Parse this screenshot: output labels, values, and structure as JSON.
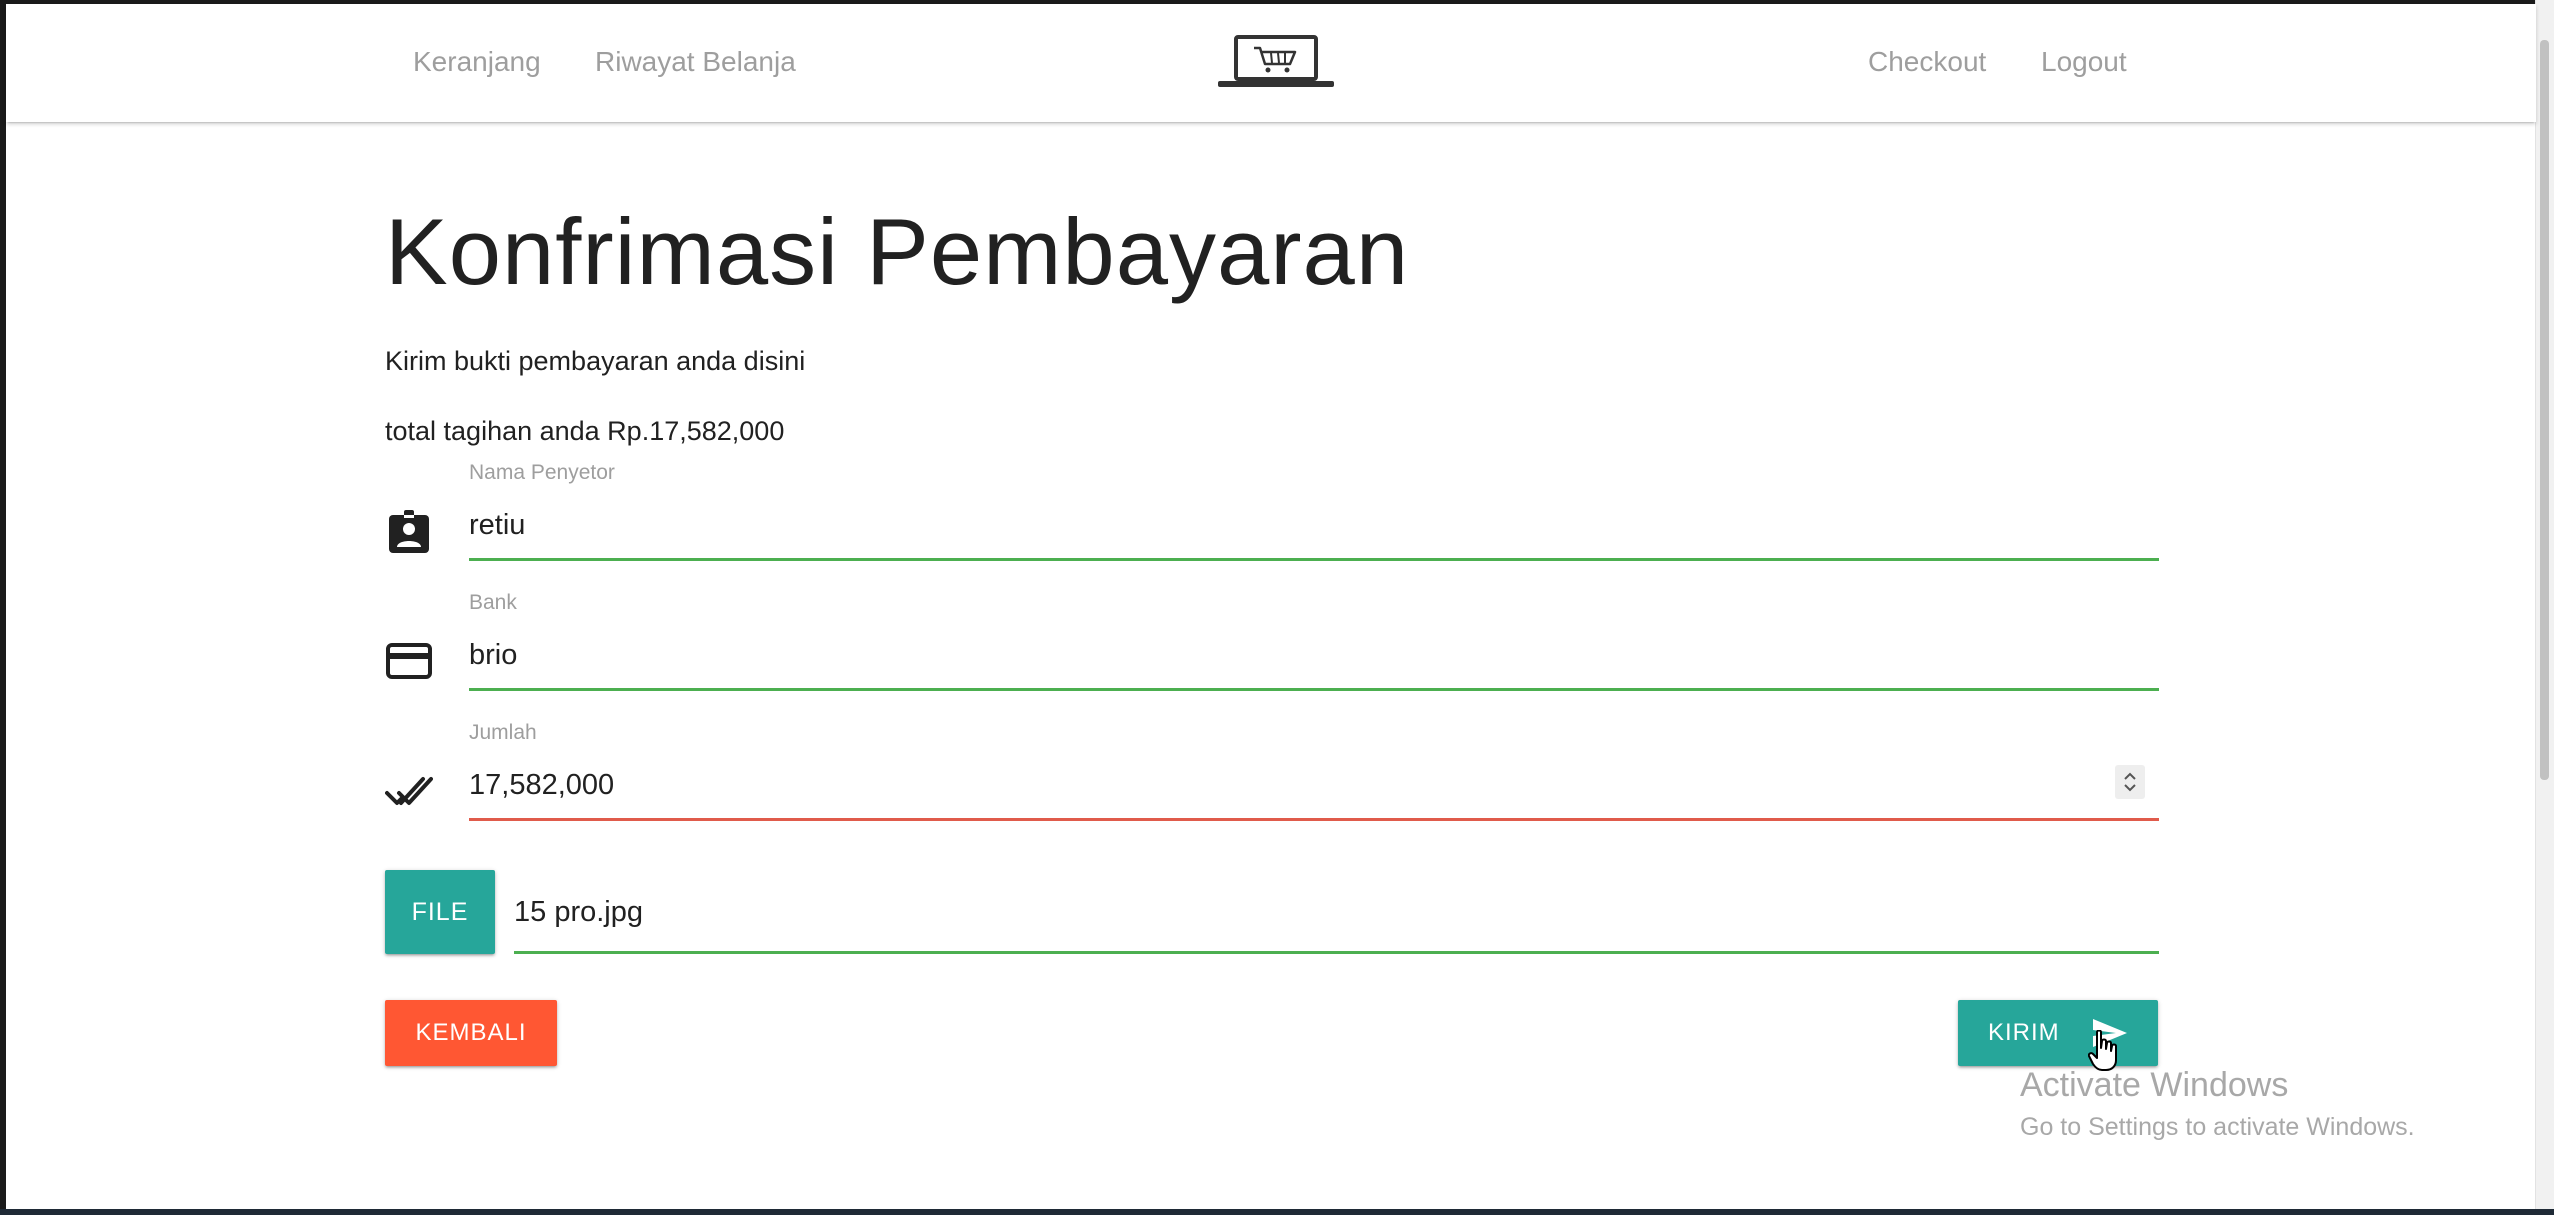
{
  "nav": {
    "links_left": [
      "Keranjang",
      "Riwayat Belanja"
    ],
    "links_right": [
      "Checkout",
      "Logout"
    ],
    "logo_icon": "laptop-cart-icon"
  },
  "page": {
    "title": "Konfrimasi Pembayaran",
    "subtitle": "Kirim bukti pembayaran anda disini",
    "total": "total tagihan anda Rp.17,582,000"
  },
  "form": {
    "name": {
      "label": "Nama Penyetor",
      "value": "retiu",
      "icon": "account-box-icon",
      "state": "valid"
    },
    "bank": {
      "label": "Bank",
      "value": "brio",
      "icon": "credit-card-icon",
      "state": "valid"
    },
    "amount": {
      "label": "Jumlah",
      "value": "17,582,000",
      "icon": "done-all-icon",
      "state": "invalid"
    },
    "file": {
      "button_label": "FILE",
      "value": "15 pro.jpg"
    }
  },
  "actions": {
    "back_label": "KEMBALI",
    "send_label": "KIRIM",
    "send_icon": "send-icon"
  },
  "watermark": {
    "title": "Activate Windows",
    "subtitle": "Go to Settings to activate Windows."
  },
  "colors": {
    "teal": "#26a69a",
    "orange_red": "#ff5733",
    "valid_line": "#4caf50",
    "invalid_line": "#e05b4b",
    "nav_text": "#9e9e9e"
  }
}
